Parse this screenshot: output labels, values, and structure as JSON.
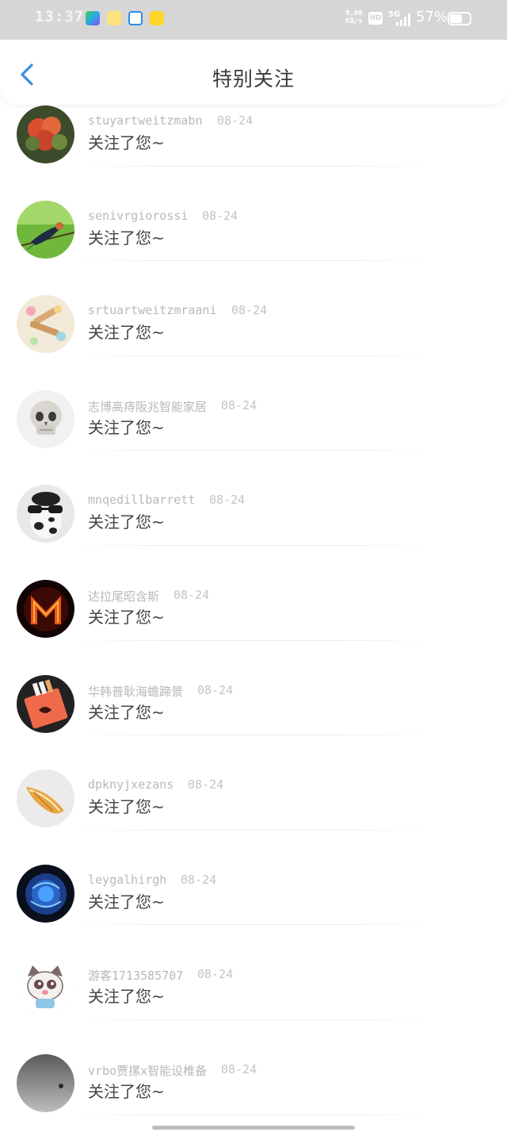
{
  "status_bar": {
    "time": "13:37",
    "network_speed_value": "9.00",
    "network_speed_unit": "KB/s",
    "hd_label": "HD",
    "network_type": "5G",
    "battery_percent": "57%",
    "battery_level": 0.57,
    "app_icons": [
      "iqiyi-app-icon",
      "baby-app-icon",
      "browser-app-icon",
      "music-app-icon"
    ]
  },
  "header": {
    "back_icon": "chevron-left-icon",
    "title": "特别关注",
    "accent_color": "#3a8ee6"
  },
  "list": [
    {
      "name": "stuyartweitzmabn",
      "date": "08-24",
      "message": "关注了您~",
      "avatar": "cactus-flower-avatar"
    },
    {
      "name": "senivrgiorossi",
      "date": "08-24",
      "message": "关注了您~",
      "avatar": "swallow-bird-avatar"
    },
    {
      "name": "srtuartweitzmraani",
      "date": "08-24",
      "message": "关注了您~",
      "avatar": "candy-food-avatar"
    },
    {
      "name": "志博高痔阪兆智能家居",
      "date": "08-24",
      "message": "关注了您~",
      "avatar": "skull-avatar"
    },
    {
      "name": "mnqedillbarrett",
      "date": "08-24",
      "message": "关注了您~",
      "avatar": "cow-sunglasses-avatar"
    },
    {
      "name": "达拉尾昭含斯",
      "date": "08-24",
      "message": "关注了您~",
      "avatar": "fire-letter-m-avatar"
    },
    {
      "name": "华韩普耿海蟾蹄景",
      "date": "08-24",
      "message": "关注了您~",
      "avatar": "cigarette-pack-avatar"
    },
    {
      "name": "dpknyjxezans",
      "date": "08-24",
      "message": "关注了您~",
      "avatar": "seashell-avatar"
    },
    {
      "name": "leygalhirgh",
      "date": "08-24",
      "message": "关注了您~",
      "avatar": "blue-rose-avatar"
    },
    {
      "name": "游客1713585707",
      "date": "08-24",
      "message": "关注了您~",
      "avatar": "cartoon-cat-avatar"
    },
    {
      "name": "vrbo贾摞x智能设椎备",
      "date": "08-24",
      "message": "关注了您~",
      "avatar": "gray-gradient-avatar"
    }
  ]
}
